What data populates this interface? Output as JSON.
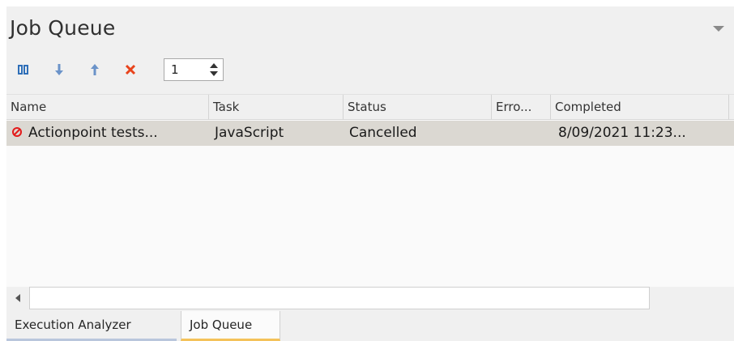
{
  "panel": {
    "title": "Job Queue"
  },
  "toolbar": {
    "buttons": [
      {
        "name": "pause-button",
        "icon": "pause-icon",
        "color": "#2f6fb8"
      },
      {
        "name": "move-down-button",
        "icon": "arrow-down-icon",
        "color": "#6b93c9"
      },
      {
        "name": "move-up-button",
        "icon": "arrow-up-icon",
        "color": "#6b93c9"
      },
      {
        "name": "delete-button",
        "icon": "x-icon",
        "color": "#e8431b"
      }
    ],
    "stepper_value": "1"
  },
  "table": {
    "columns": [
      "Name",
      "Task",
      "Status",
      "Erro...",
      "Completed"
    ],
    "rows": [
      {
        "status_icon": "cancelled-icon",
        "name": "Actionpoint tests...",
        "task": "JavaScript",
        "status": "Cancelled",
        "error": "",
        "completed": "8/09/2021 11:23..."
      }
    ]
  },
  "tabs": [
    {
      "label": "Execution Analyzer",
      "active": false
    },
    {
      "label": "Job Queue",
      "active": true
    }
  ],
  "colors": {
    "selected_row": "#dbd8d2",
    "active_tab_underline": "#f4c25a",
    "inactive_tab_underline": "#b9c6dc",
    "cancel_icon": "#e31b1b"
  }
}
